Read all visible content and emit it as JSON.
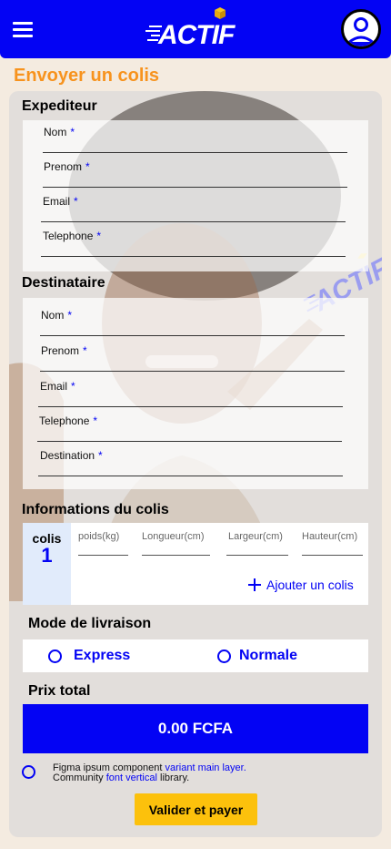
{
  "header": {
    "logo_text": "ACTIF",
    "icons": {
      "menu": "hamburger-menu-icon",
      "profile": "user-avatar-icon"
    }
  },
  "page_title": "Envoyer un colis",
  "expediteur": {
    "title": "Expediteur",
    "fields": [
      {
        "label": "Nom",
        "required": "*"
      },
      {
        "label": "Prenom",
        "required": "*"
      },
      {
        "label": "Email",
        "required": "*"
      },
      {
        "label": "Telephone",
        "required": "*"
      }
    ]
  },
  "destinataire": {
    "title": "Destinataire",
    "fields": [
      {
        "label": "Nom",
        "required": "*"
      },
      {
        "label": "Prenom",
        "required": "*"
      },
      {
        "label": "Email",
        "required": "*"
      },
      {
        "label": "Telephone",
        "required": "*"
      },
      {
        "label": "Destination",
        "required": "*"
      }
    ]
  },
  "colis": {
    "title": "Informations du colis",
    "counter_label": "colis",
    "counter_value": "1",
    "dimensions": [
      "poids(kg)",
      "Longueur(cm)",
      "Largeur(cm)",
      "Hauteur(cm)"
    ],
    "add_label": "Ajouter un colis"
  },
  "delivery": {
    "title": "Mode de livraison",
    "options": [
      "Express",
      "Normale"
    ]
  },
  "price": {
    "title": "Prix total",
    "value": "0.00 FCFA"
  },
  "terms": {
    "line1_a": "Figma ipsum component ",
    "line1_link": "variant main layer.",
    "line2_a": "Community ",
    "line2_link": "font vertical",
    "line2_b": " library."
  },
  "submit_label": "Valider et payer",
  "colors": {
    "brand_blue": "#0303f4",
    "title_orange": "#f7931e",
    "button_yellow": "#fcc10c",
    "background": "#f4ebe0"
  }
}
